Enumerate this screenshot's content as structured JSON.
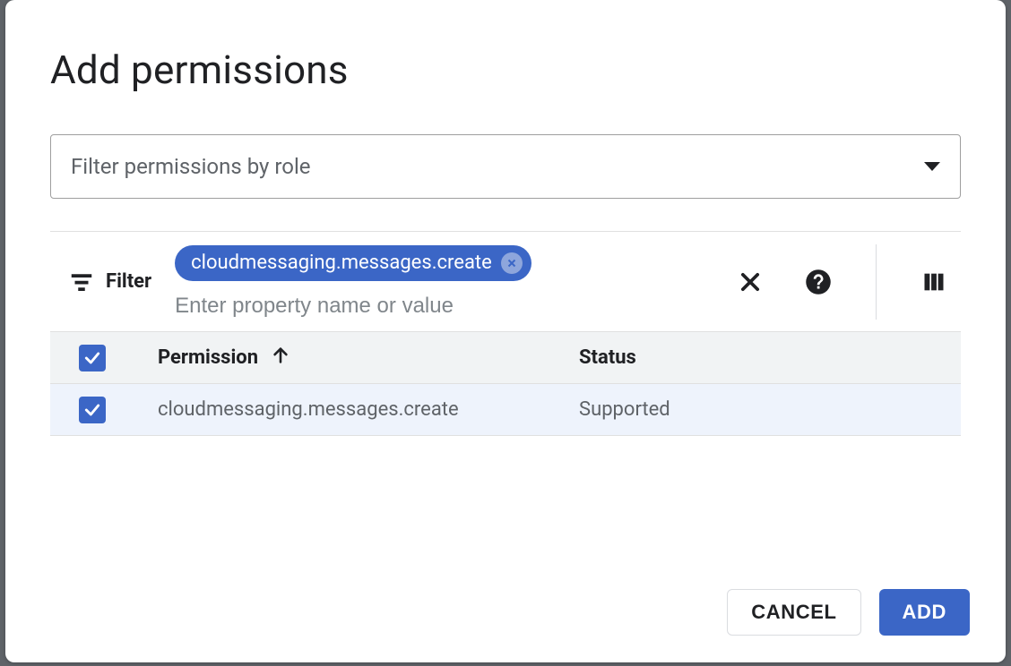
{
  "dialog": {
    "title": "Add permissions",
    "roleFilter": {
      "placeholder": "Filter permissions by role"
    }
  },
  "filter": {
    "label": "Filter",
    "chip": "cloudmessaging.messages.create",
    "inputPlaceholder": "Enter property name or value"
  },
  "table": {
    "headers": {
      "permission": "Permission",
      "status": "Status"
    },
    "rows": [
      {
        "permission": "cloudmessaging.messages.create",
        "status": "Supported",
        "checked": true
      }
    ]
  },
  "buttons": {
    "cancel": "CANCEL",
    "add": "ADD"
  }
}
